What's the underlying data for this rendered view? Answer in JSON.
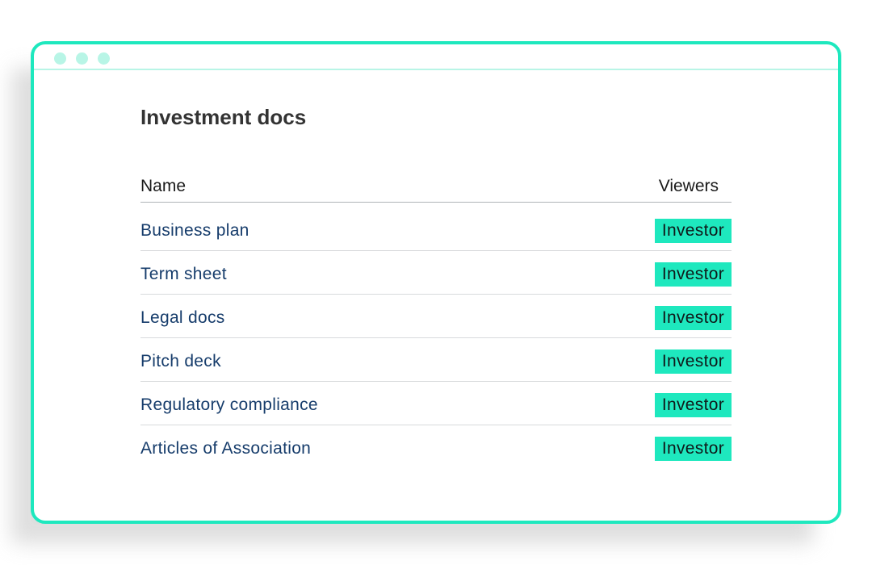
{
  "window": {
    "accent_color": "#1ee8be",
    "dot_color": "#b8f5e6",
    "title_dots": [
      "dot",
      "dot",
      "dot"
    ]
  },
  "page": {
    "title": "Investment docs"
  },
  "table": {
    "columns": {
      "name": "Name",
      "viewers": "Viewers"
    },
    "rows": [
      {
        "name": "Business plan",
        "viewer": "Investor"
      },
      {
        "name": "Term sheet",
        "viewer": "Investor"
      },
      {
        "name": "Legal docs",
        "viewer": "Investor"
      },
      {
        "name": "Pitch deck",
        "viewer": "Investor"
      },
      {
        "name": "Regulatory compliance",
        "viewer": "Investor"
      },
      {
        "name": "Articles of Association",
        "viewer": "Investor"
      }
    ]
  }
}
